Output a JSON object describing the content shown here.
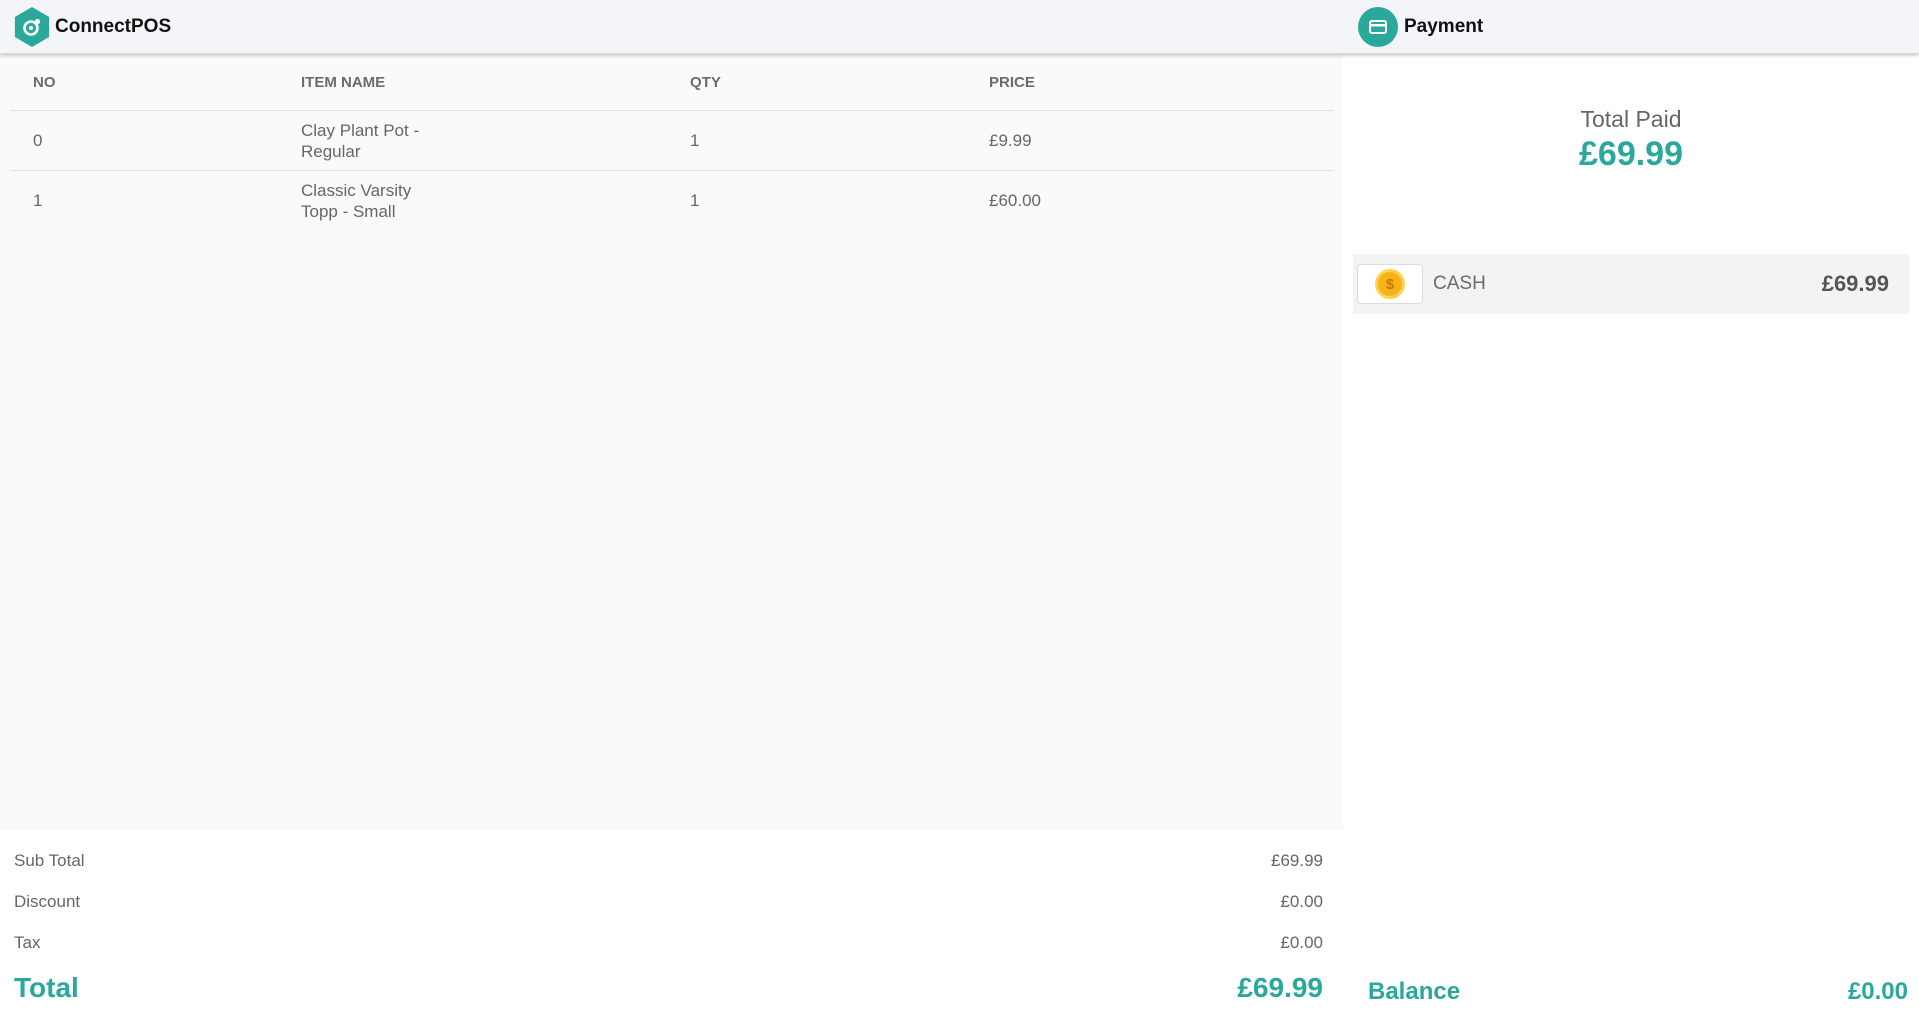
{
  "header": {
    "brand": "ConnectPOS",
    "payment_title": "Payment"
  },
  "order": {
    "columns": [
      "NO",
      "ITEM NAME",
      "QTY",
      "PRICE"
    ],
    "rows": [
      {
        "no": "0",
        "name_line1": "Clay Plant Pot -",
        "name_line2": "Regular",
        "qty": "1",
        "price": "£9.99"
      },
      {
        "no": "1",
        "name_line1": "Classic Varsity",
        "name_line2": "Topp - Small",
        "qty": "1",
        "price": "£60.00"
      }
    ]
  },
  "totals": {
    "subtotal_label": "Sub Total",
    "subtotal_value": "£69.99",
    "discount_label": "Discount",
    "discount_value": "£0.00",
    "tax_label": "Tax",
    "tax_value": "£0.00",
    "total_label": "Total",
    "total_value": "£69.99"
  },
  "payment": {
    "total_paid_label": "Total Paid",
    "total_paid_value": "£69.99",
    "method_name": "CASH",
    "method_amount": "£69.99",
    "balance_label": "Balance",
    "balance_value": "£0.00"
  },
  "colors": {
    "accent": "#2aa89c",
    "coin": "#f7b21a"
  },
  "icons": {
    "brand": "connectpos-logo-icon",
    "payment": "credit-card-icon",
    "cash": "coin-icon"
  }
}
